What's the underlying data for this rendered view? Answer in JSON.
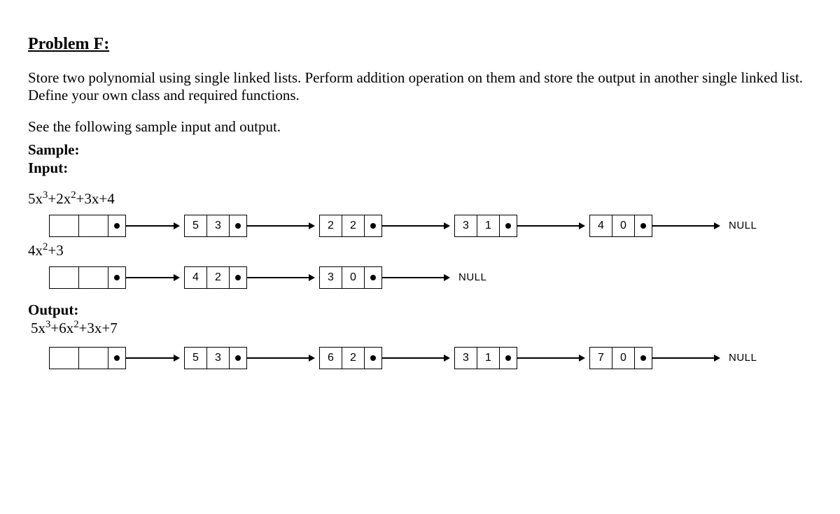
{
  "title": "Problem F:",
  "description": "Store two polynomial using single linked lists. Perform addition operation on them and store the output in another single linked list.  Define your own class and required functions.",
  "see_text": "See the following sample input and output.",
  "sample_label": "Sample:",
  "input_label": "Input:",
  "output_label": "Output:",
  "null_label": "NULL",
  "poly1": {
    "coef3": "5",
    "coef2": "2",
    "coef1": "3",
    "coef0": "4"
  },
  "poly2": {
    "coef2": "4",
    "coef0": "3"
  },
  "poly3": {
    "coef3": "5",
    "coef2": "6",
    "coef1": "3",
    "coef0": "7"
  },
  "list1": {
    "n1": {
      "a": "5",
      "b": "3"
    },
    "n2": {
      "a": "2",
      "b": "2"
    },
    "n3": {
      "a": "3",
      "b": "1"
    },
    "n4": {
      "a": "4",
      "b": "0"
    }
  },
  "list2": {
    "n1": {
      "a": "4",
      "b": "2"
    },
    "n2": {
      "a": "3",
      "b": "0"
    }
  },
  "list3": {
    "n1": {
      "a": "5",
      "b": "3"
    },
    "n2": {
      "a": "6",
      "b": "2"
    },
    "n3": {
      "a": "3",
      "b": "1"
    },
    "n4": {
      "a": "7",
      "b": "0"
    }
  }
}
